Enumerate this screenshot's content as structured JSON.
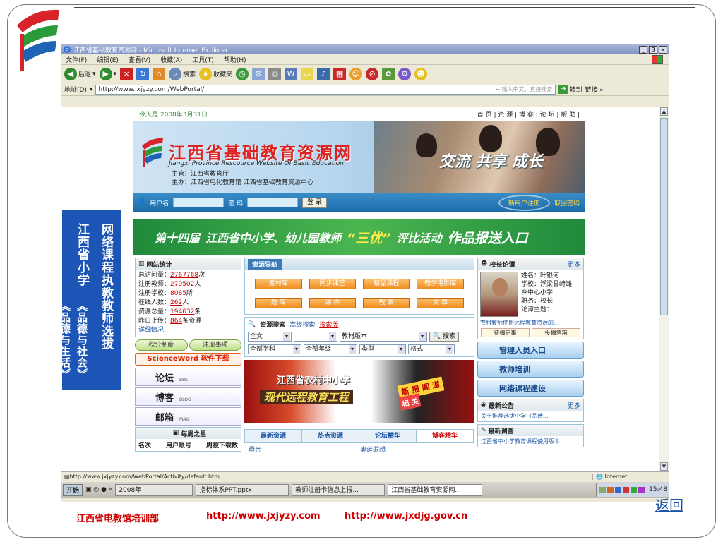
{
  "window": {
    "title": "江西省基础教育资源网 - Microsoft Internet Explorer",
    "controls": [
      "_",
      "8",
      "×"
    ]
  },
  "menu": [
    "文件(F)",
    "编辑(E)",
    "查看(V)",
    "收藏(A)",
    "工具(T)",
    "帮助(H)"
  ],
  "toolbar": {
    "back": "后退",
    "search": "搜索",
    "favorites": "收藏夹"
  },
  "address": {
    "label": "地址(D)",
    "url": "http://www.jxjyzy.com/WebPortal/",
    "hint": "← 输入中文，直接搜索",
    "go": "转到",
    "links": "链接 »"
  },
  "site": {
    "date": "今天是 2008年3月31日",
    "topnav": "| 首 页 | 资 源 | 博 客 | 论 坛 | 帮 助 |",
    "name": "江西省基础教育资源网",
    "english": "Jiangxi Province Rescource Website Of Basic Education",
    "org1": "主管：江西省教育厅",
    "org2": "主办：江西省电化教育馆  江西省基础教育资源中心",
    "slogan": "交流 共享 成长",
    "login": {
      "user": "用户名",
      "pwd": "密 码",
      "button": "登 录",
      "register": "新用户注册",
      "recover": "取回密码"
    },
    "banner": {
      "part1": "第十四届",
      "part2": "江西省中小学、幼儿园教师",
      "part3": "“三优”",
      "part4": "评比活动",
      "part5": "作品报送入口"
    },
    "stats": {
      "title": "网站统计",
      "rows": [
        {
          "label": "总访问量：",
          "value": "2767768",
          "unit": "次"
        },
        {
          "label": "注册教师：",
          "value": "279502",
          "unit": "人"
        },
        {
          "label": "注册学校：",
          "value": "8085",
          "unit": "所"
        },
        {
          "label": "在线人数：",
          "value": "262",
          "unit": "人"
        },
        {
          "label": "资源总量：",
          "value": "194632",
          "unit": "条"
        },
        {
          "label": "昨日上传：",
          "value": "864",
          "unit": "条资源"
        }
      ],
      "detail": "详细情况"
    },
    "pills": [
      "积分制度",
      "注册事项"
    ],
    "sciword": "ScienceWord 软件下载",
    "big_links": [
      {
        "label": "论坛",
        "sub": "BBS"
      },
      {
        "label": "博客",
        "sub": "BLOG"
      },
      {
        "label": "邮箱",
        "sub": "MAIL"
      }
    ],
    "week_star": {
      "title": "每周之星",
      "col1": "名次",
      "col2": "用户账号",
      "col3": "周被下载数"
    },
    "resource_nav": {
      "title": "资源导航",
      "buttons": [
        "素材库",
        "同步课堂",
        "精品课程",
        "教学电影库",
        "题 库",
        "课 件",
        "教 案",
        "文 章"
      ]
    },
    "search": {
      "title": "资源搜索",
      "adv": "高级搜索",
      "search_ver": "搜索版",
      "sel1": "全文",
      "sel3": "教材版本",
      "sel4": "全部学科",
      "sel5": "全部年级",
      "sel6": "类型",
      "sel7": "格式",
      "button": "搜索"
    },
    "project": {
      "line1": "江西省农村中小学",
      "line2": "现代远程教育工程",
      "tag1": "新 报 闻 道",
      "tag2": "相 关"
    },
    "tabs": [
      "最新资源",
      "热点资源",
      "论坛精华",
      "博客精华"
    ],
    "tab_items": [
      "母亲",
      "奥运遐想"
    ],
    "principal": {
      "title": "校长论谭",
      "more": "更多",
      "name": "姓名：叶银河",
      "school": "学校：浮梁县峙滩",
      "school2": "乡中心小学",
      "job": "职务：校长",
      "topic": "论谭主题：",
      "desc": "农村教师使用远程教育资源的...",
      "btn1": "征稿启事",
      "btn2": "投稿信箱"
    },
    "side_buttons": [
      "管理人员入口",
      "教师培训",
      "网络课程建设"
    ],
    "notice": {
      "title": "最新公告",
      "more": "更多",
      "item": "关于推荐选拔小学《品德..."
    },
    "survey": {
      "title": "最新调查",
      "item": "江西省中小学教育课程使用版本"
    }
  },
  "status": {
    "url": "http://www.jxjyzy.com/WebPortal/Activity/default.htm",
    "zone": "Internet"
  },
  "taskbar": {
    "start": "开始",
    "items": [
      "2008年",
      "指标体系PPT.pptx",
      "教师注册卡信息上报...",
      "江西省基础教育资源网..."
    ],
    "clock": "15:48"
  },
  "poster": {
    "col1": "网络课程执教教师选拔",
    "col2": "江西省小学",
    "col3": "《品德与社会》《品德与生活》"
  },
  "footer": {
    "org": "江西省电教馆培训部",
    "url1": "http://www.jxjyzy.com",
    "url2": "http://www.jxdjg.gov.cn",
    "return": "返回"
  },
  "colors": {
    "ie_title": "#7f92c3",
    "site_blue": "#1b6aa8",
    "banner_green": "#1f8a3a",
    "nav_orange": "#f18c1e",
    "footer_red": "#cc0000"
  }
}
